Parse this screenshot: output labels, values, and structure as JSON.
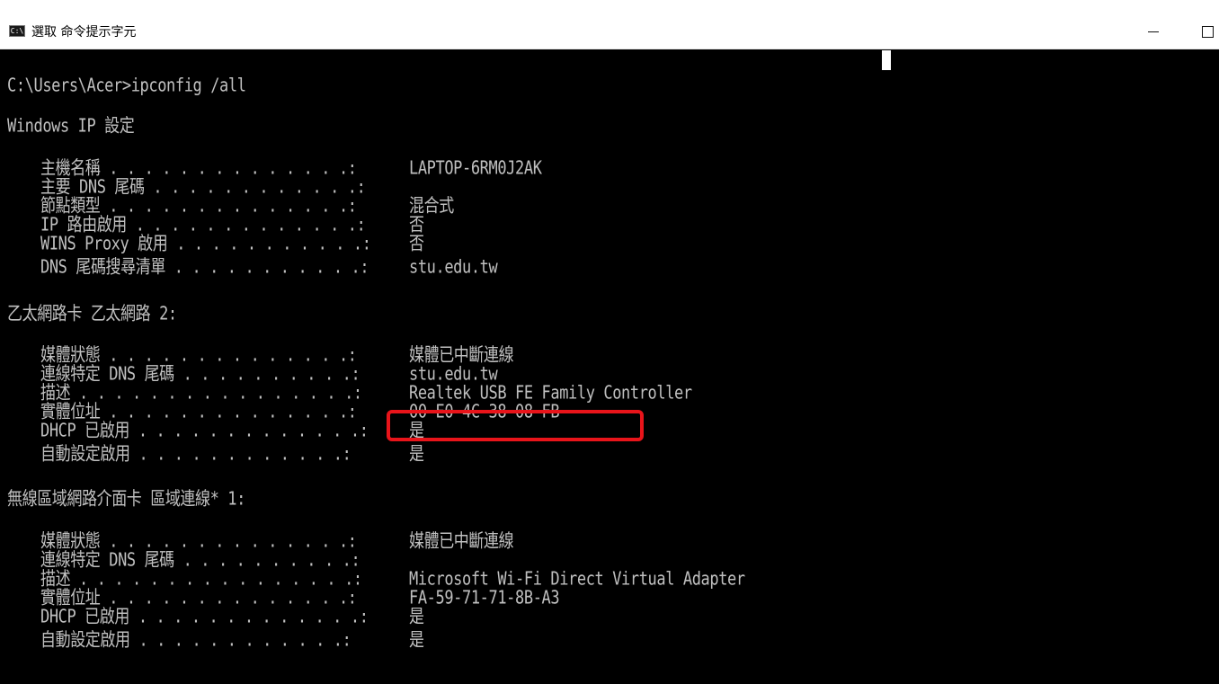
{
  "window": {
    "title": "選取 命令提示字元",
    "icon_label": "C:\\",
    "controls": [
      "minimize-icon",
      "maximize-icon"
    ]
  },
  "console": {
    "prompt": "C:\\Users\\Acer>ipconfig /all",
    "header": "Windows IP 設定",
    "ip_config": [
      {
        "label": "主機名稱",
        "dots": " . . . . . . . . . . . . . .:",
        "value": "LAPTOP-6RM0J2AK"
      },
      {
        "label": "主要 DNS 尾碼",
        "dots": " . . . . . . . . . . . .:",
        "value": ""
      },
      {
        "label": "節點類型",
        "dots": " . . . . . . . . . . . . . .:",
        "value": "混合式"
      },
      {
        "label": "IP 路由啟用",
        "dots": " . . . . . . . . . . . . .:",
        "value": "否"
      },
      {
        "label": "WINS Proxy 啟用",
        "dots": " . . . . . . . . . . .:",
        "value": "否"
      },
      {
        "label": "DNS 尾碼搜尋清單",
        "dots": " . . . . . . . . . . .:",
        "value": "stu.edu.tw"
      }
    ],
    "adapter1": {
      "header": "乙太網路卡 乙太網路 2:",
      "rows": [
        {
          "label": "媒體狀態",
          "dots": " . . . . . . . . . . . . . .:",
          "value": "媒體已中斷連線"
        },
        {
          "label": "連線特定 DNS 尾碼",
          "dots": " . . . . . . . . . .:",
          "value": "stu.edu.tw"
        },
        {
          "label": "描述",
          "dots": " . . . . . . . . . . . . . . . .:",
          "value": "Realtek USB FE Family Controller"
        },
        {
          "label": "實體位址",
          "dots": " . . . . . . . . . . . . . .:",
          "value": "00-E0-4C-38-08-FB"
        },
        {
          "label": "DHCP 已啟用",
          "dots": " . . . . . . . . . . . . .:",
          "value": "是"
        },
        {
          "label": "自動設定啟用",
          "dots": " . . . . . . . . . . . .:",
          "value": "是"
        }
      ]
    },
    "adapter2": {
      "header": "無線區域網路介面卡 區域連線* 1:",
      "rows": [
        {
          "label": "媒體狀態",
          "dots": " . . . . . . . . . . . . . .:",
          "value": "媒體已中斷連線"
        },
        {
          "label": "連線特定 DNS 尾碼",
          "dots": " . . . . . . . . . .:",
          "value": ""
        },
        {
          "label": "描述",
          "dots": " . . . . . . . . . . . . . . . .:",
          "value": "Microsoft Wi-Fi Direct Virtual Adapter"
        },
        {
          "label": "實體位址",
          "dots": " . . . . . . . . . . . . . .:",
          "value": "FA-59-71-71-8B-A3"
        },
        {
          "label": "DHCP 已啟用",
          "dots": " . . . . . . . . . . . . .:",
          "value": "是"
        },
        {
          "label": "自動設定啟用",
          "dots": " . . . . . . . . . . . .:",
          "value": "是"
        }
      ]
    }
  },
  "colors": {
    "console_bg": "#000000",
    "console_fg": "#c0c0c0",
    "highlight": "#e8141a"
  }
}
